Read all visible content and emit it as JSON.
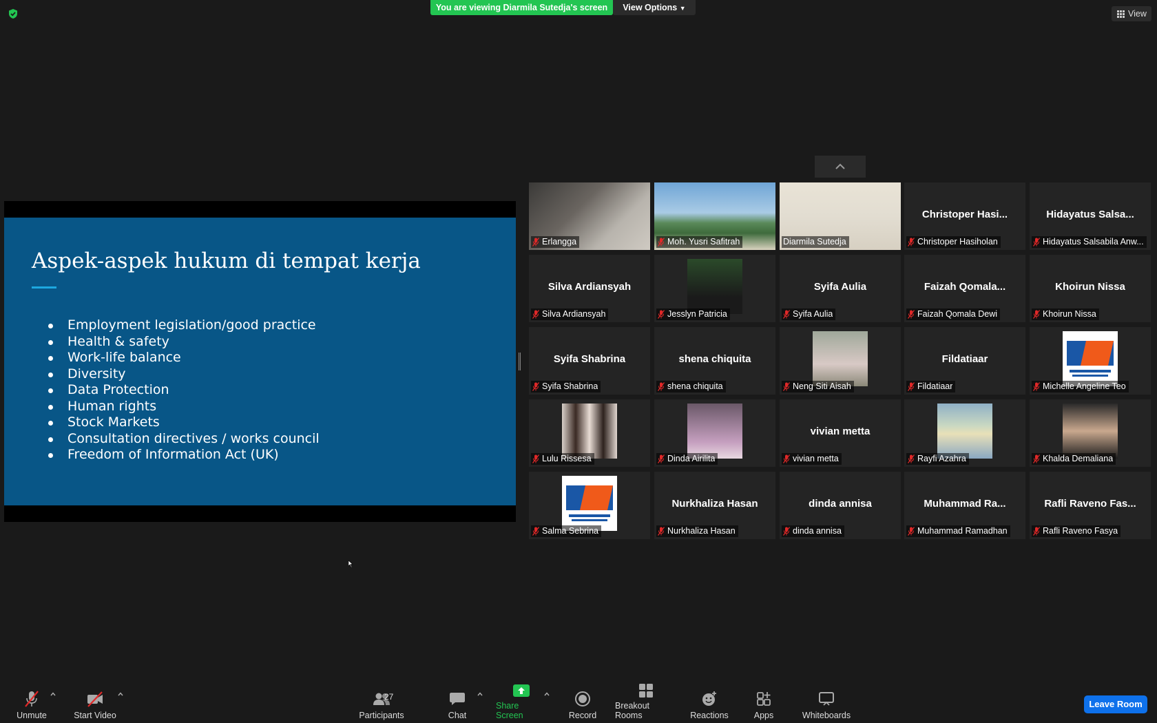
{
  "top": {
    "banner": "You are viewing Diarmila Sutedja's screen",
    "view_options": "View Options",
    "view": "View"
  },
  "slide": {
    "title": "Aspek-aspek hukum di tempat kerja",
    "bullets": [
      "Employment legislation/good practice",
      "Health & safety",
      "Work-life balance",
      "Diversity",
      "Data Protection",
      "Human rights",
      "Stock Markets",
      "Consultation directives / works council",
      "Freedom of Information Act (UK)"
    ]
  },
  "participants": [
    {
      "label": "Erlangga",
      "big": "",
      "kind": "video"
    },
    {
      "label": "Moh. Yusri Safitrah",
      "big": "",
      "kind": "video"
    },
    {
      "label": "Diarmila Sutedja",
      "big": "",
      "kind": "video",
      "active": true
    },
    {
      "label": "Christoper Hasiholan",
      "big": "Christoper  Hasi..."
    },
    {
      "label": "Hidayatus Salsabila Anw...",
      "big": "Hidayatus  Salsa..."
    },
    {
      "label": "Silva Ardiansyah",
      "big": "Silva Ardiansyah"
    },
    {
      "label": "Jesslyn Patricia",
      "big": "",
      "kind": "photo"
    },
    {
      "label": "Syifa Aulia",
      "big": "Syifa Aulia"
    },
    {
      "label": "Faizah Qomala Dewi",
      "big": "Faizah  Qomala..."
    },
    {
      "label": "Khoirun Nissa",
      "big": "Khoirun Nissa"
    },
    {
      "label": "Syifa Shabrina",
      "big": "Syifa Shabrina"
    },
    {
      "label": "shena chiquita",
      "big": "shena chiquita"
    },
    {
      "label": "Neng Siti Aisah",
      "big": "",
      "kind": "photo"
    },
    {
      "label": "Fildatiaar",
      "big": "Fildatiaar"
    },
    {
      "label": "Michelle Angeline Teo",
      "big": "",
      "kind": "logo"
    },
    {
      "label": "Lulu Rissesa",
      "big": "",
      "kind": "photo"
    },
    {
      "label": "Dinda Airilita",
      "big": "",
      "kind": "photo"
    },
    {
      "label": "vivian metta",
      "big": "vivian metta"
    },
    {
      "label": "Rayfi Azahra",
      "big": "",
      "kind": "photo"
    },
    {
      "label": "Khalda Demaliana",
      "big": "",
      "kind": "photo"
    },
    {
      "label": "Salma Sebrina",
      "big": "",
      "kind": "logo"
    },
    {
      "label": "Nurkhaliza Hasan",
      "big": "Nurkhaliza Hasan"
    },
    {
      "label": "dinda annisa",
      "big": "dinda annisa"
    },
    {
      "label": "Muhammad Ramadhan",
      "big": "Muhammad  Ra..."
    },
    {
      "label": "Rafli Raveno Fasya",
      "big": "Rafli Raveno Fas..."
    }
  ],
  "toolbar": {
    "unmute": "Unmute",
    "start_video": "Start Video",
    "participants": "Participants",
    "participants_count": "27",
    "chat": "Chat",
    "share_screen": "Share Screen",
    "record": "Record",
    "breakout_rooms": "Breakout Rooms",
    "reactions": "Reactions",
    "apps": "Apps",
    "whiteboards": "Whiteboards",
    "leave": "Leave Room"
  },
  "colors": {
    "share_green": "#23c552",
    "active_speaker": "#d2f063",
    "leave_blue": "#0e71eb",
    "slide_bg": "#085687"
  }
}
